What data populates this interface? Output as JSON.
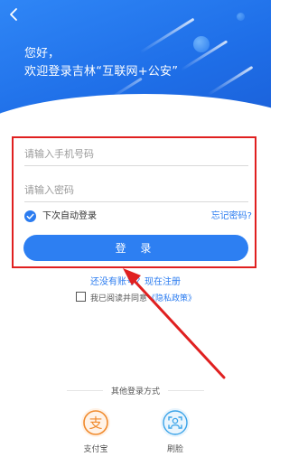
{
  "header": {
    "greeting_line1": "您好，",
    "greeting_line2": "欢迎登录吉林“互联网+公安”"
  },
  "form": {
    "phone_placeholder": "请输入手机号码",
    "phone_value": "",
    "password_placeholder": "请输入密码",
    "password_value": "",
    "auto_login_label": "下次自动登录",
    "auto_login_checked": true,
    "forgot_label": "忘记密码?",
    "login_label": "登 录"
  },
  "register_label": "还没有账号？现在注册",
  "agreement": {
    "prefix": "我已阅读并同意",
    "policy_label": "《隐私政策》",
    "checked": false
  },
  "other_login": {
    "title": "其他登录方式",
    "options": [
      {
        "label": "支付宝",
        "icon": "alipay-icon"
      },
      {
        "label": "刷脸",
        "icon": "face-scan-icon"
      }
    ]
  },
  "colors": {
    "brand_blue": "#2d7ff2",
    "annotation_red": "#e02020",
    "alipay_orange": "#f08a2c"
  }
}
